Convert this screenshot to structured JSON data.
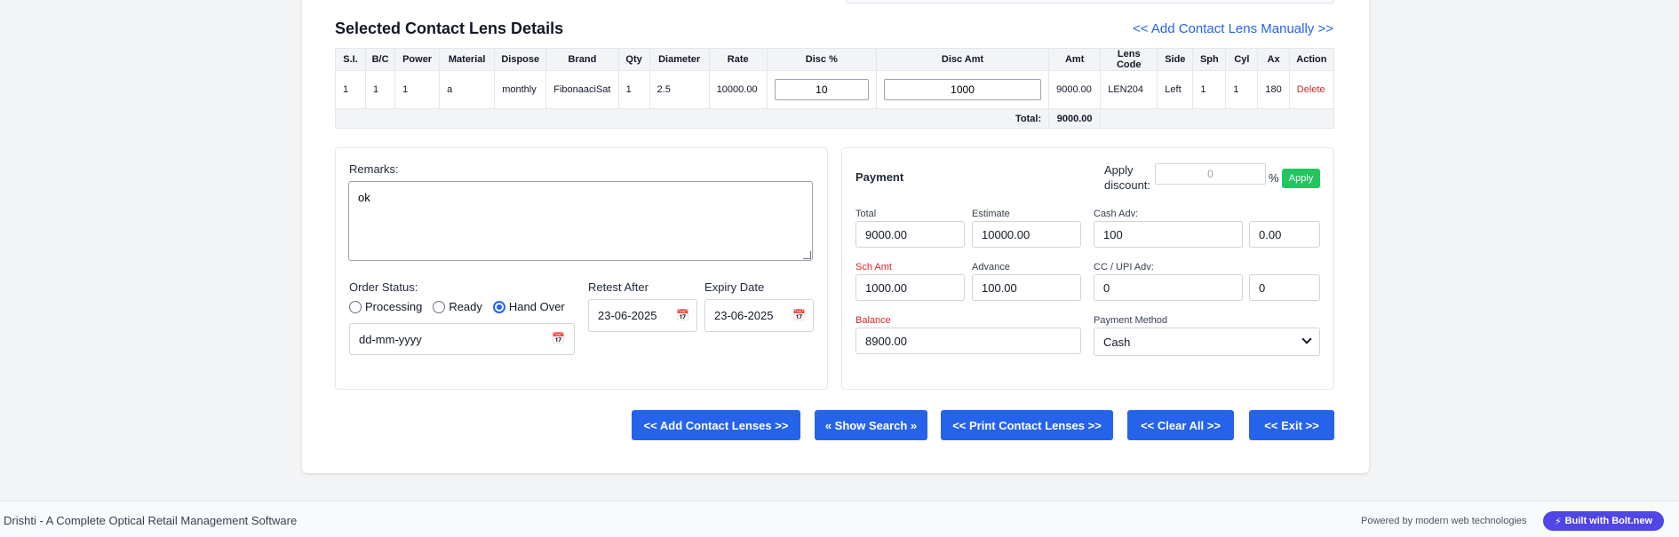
{
  "section": {
    "title": "Selected Contact Lens Details",
    "add_manual": "<< Add Contact Lens Manually >>"
  },
  "table": {
    "headers": [
      "S.I.",
      "B/C",
      "Power",
      "Material",
      "Dispose",
      "Brand",
      "Qty",
      "Diameter",
      "Rate",
      "Disc %",
      "Disc Amt",
      "Amt",
      "Lens Code",
      "Side",
      "Sph",
      "Cyl",
      "Ax",
      "Action"
    ],
    "rows": [
      {
        "si": "1",
        "bc": "1",
        "power": "1",
        "material": "a",
        "dispose": "monthly",
        "brand": "FibonaaciSat",
        "qty": "1",
        "diameter": "2.5",
        "rate": "10000.00",
        "disc_pct": "10",
        "disc_amt": "1000",
        "amt": "9000.00",
        "lens_code": "LEN204",
        "side": "Left",
        "sph": "1",
        "cyl": "1",
        "ax": "180",
        "action": "Delete"
      }
    ],
    "total_label": "Total:",
    "total_value": "9000.00"
  },
  "remarks": {
    "label": "Remarks:",
    "value": "ok"
  },
  "order_status": {
    "label": "Order Status:",
    "options": [
      "Processing",
      "Ready",
      "Hand Over"
    ],
    "selected": "Hand Over",
    "date_placeholder": "dd-mm-yyyy"
  },
  "retest": {
    "label": "Retest After",
    "value": "23-06-2025"
  },
  "expiry": {
    "label": "Expiry Date",
    "value": "23-06-2025"
  },
  "payment": {
    "title": "Payment",
    "apply_discount_label": "Apply discount:",
    "discount_value": "0",
    "pct": "%",
    "apply_button": "Apply",
    "total_label": "Total",
    "total": "9000.00",
    "estimate_label": "Estimate",
    "estimate": "10000.00",
    "cash_adv_label": "Cash Adv:",
    "cash_adv": "100",
    "cash_adv_extra": "0.00",
    "sch_amt_label": "Sch Amt",
    "sch_amt": "1000.00",
    "advance_label": "Advance",
    "advance": "100.00",
    "cc_label": "CC / UPI Adv:",
    "cc": "0",
    "cc_extra": "0",
    "balance_label": "Balance",
    "balance": "8900.00",
    "method_label": "Payment Method",
    "method": "Cash"
  },
  "buttons": {
    "add": "<< Add Contact Lenses >>",
    "search": "« Show Search »",
    "print": "<< Print Contact Lenses >>",
    "clear": "<< Clear All >>",
    "exit": "<< Exit >>"
  },
  "footer": {
    "text": "Drishti - A Complete Optical Retail Management Software",
    "powered": "Powered by modern web technologies",
    "bolt": "Built with Bolt.new"
  },
  "colors": {
    "primary": "#2563eb",
    "apply": "#22c55e",
    "danger": "#dc2626",
    "bolt": "#4f46e5"
  }
}
